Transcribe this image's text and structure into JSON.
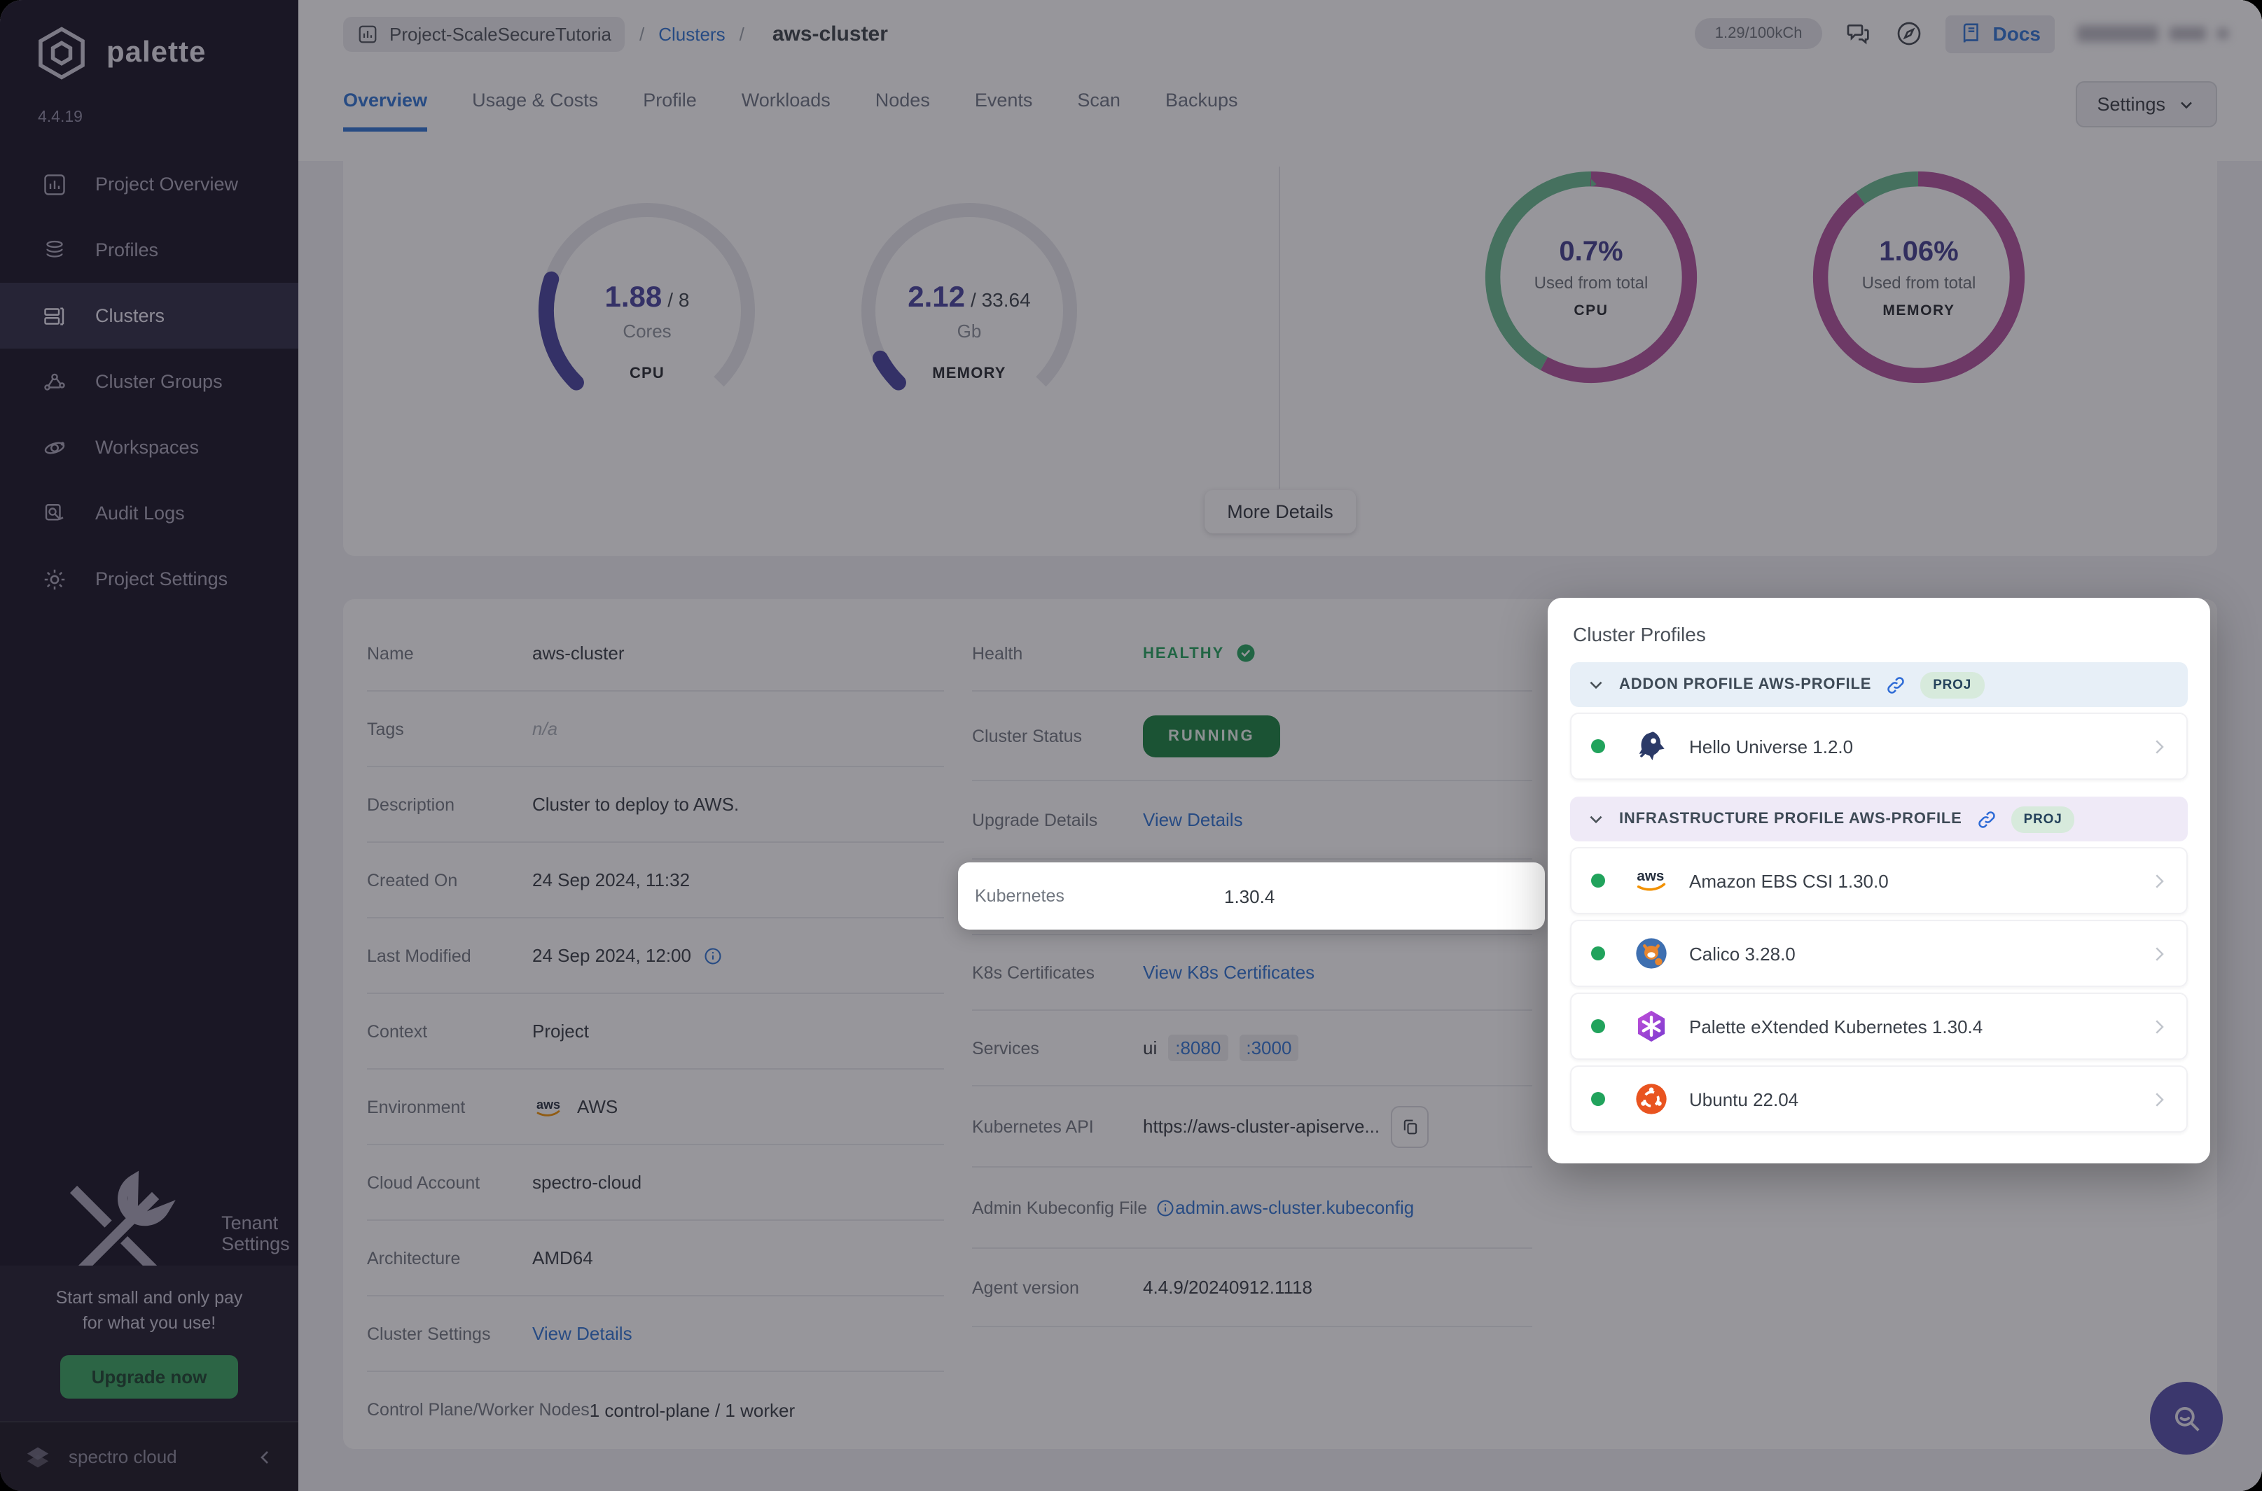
{
  "brand": {
    "name": "palette",
    "version": "4.4.19",
    "footer": "spectro cloud"
  },
  "sidebar": {
    "items": [
      {
        "label": "Project Overview"
      },
      {
        "label": "Profiles"
      },
      {
        "label": "Clusters"
      },
      {
        "label": "Cluster Groups"
      },
      {
        "label": "Workspaces"
      },
      {
        "label": "Audit Logs"
      },
      {
        "label": "Project Settings"
      }
    ],
    "active_item": "Clusters",
    "tenant_settings": "Tenant Settings",
    "promo_line1": "Start small and only pay",
    "promo_line2": "for what you use!",
    "upgrade_cta": "Upgrade now"
  },
  "header": {
    "project": "Project-ScaleSecureTutoria",
    "sep1": "/",
    "section": "Clusters",
    "sep2": "/",
    "current": "aws-cluster",
    "usage_badge": "1.29/100kCh",
    "docs_label": "Docs"
  },
  "tabs": {
    "t0": "Overview",
    "t1": "Usage & Costs",
    "t2": "Profile",
    "t3": "Workloads",
    "t4": "Nodes",
    "t5": "Events",
    "t6": "Scan",
    "t7": "Backups",
    "active": "Overview",
    "settings": "Settings"
  },
  "summary": {
    "more_details": "More Details"
  },
  "metrics": {
    "cpu_gauge": {
      "used": "1.88",
      "total": "/ 8",
      "unit": "Cores",
      "label": "CPU",
      "fraction": 0.235,
      "dash_track": "75 25",
      "dash_fill": "17.6 82.4"
    },
    "memory_gauge": {
      "used": "2.12",
      "total": "/ 33.64",
      "unit": "Gb",
      "label": "MEMORY",
      "fraction": 0.063,
      "dash_track": "75 25",
      "dash_fill": "4.7 95.3"
    },
    "cpu_donut": {
      "value": "0.7%",
      "caption": "Used from total",
      "label": "CPU",
      "green_fraction": 0.42,
      "dash_primary": "58 42",
      "dash_secondary": "42 58",
      "offset_secondary": "-58"
    },
    "memory_donut": {
      "value": "1.06%",
      "caption": "Used from total",
      "label": "MEMORY",
      "green_fraction": 0.1,
      "dash_primary": "90 10",
      "dash_secondary": "10 90",
      "offset_secondary": "-90"
    }
  },
  "details": {
    "left": [
      {
        "label": "Name",
        "value": "aws-cluster"
      },
      {
        "label": "Tags",
        "value": "n/a"
      },
      {
        "label": "Description",
        "value": "Cluster to deploy to AWS."
      },
      {
        "label": "Created On",
        "value": "24 Sep 2024, 11:32"
      },
      {
        "label": "Last Modified",
        "value": "24 Sep 2024, 12:00"
      },
      {
        "label": "Context",
        "value": "Project"
      },
      {
        "label": "Environment",
        "value": "AWS"
      },
      {
        "label": "Cloud Account",
        "value": "spectro-cloud"
      },
      {
        "label": "Architecture",
        "value": "AMD64"
      },
      {
        "label": "Cluster Settings",
        "value": "View Details"
      },
      {
        "label": "Control Plane/Worker Nodes",
        "value": "1 control-plane / 1 worker"
      }
    ],
    "right": [
      {
        "label": "Health",
        "value": "HEALTHY"
      },
      {
        "label": "Cluster Status",
        "value": "RUNNING"
      },
      {
        "label": "Upgrade Details",
        "value": "View Details"
      },
      {
        "label": "Kubernetes",
        "value": "1.30.4"
      },
      {
        "label": "K8s Certificates",
        "value": "View K8s Certificates"
      },
      {
        "label": "Services",
        "value": "ui",
        "port1": ":8080",
        "port2": ":3000"
      },
      {
        "label": "Kubernetes API",
        "value": "https://aws-cluster-apiserve..."
      },
      {
        "label": "Admin Kubeconfig File",
        "value": "admin.aws-cluster.kubeconfig"
      },
      {
        "label": "Agent version",
        "value": "4.4.9/20240912.1118"
      }
    ]
  },
  "profiles": {
    "title": "Cluster Profiles",
    "badge": "PROJ",
    "addon_header": "ADDON PROFILE AWS-PROFILE",
    "infra_header": "INFRASTRUCTURE PROFILE AWS-PROFILE",
    "addon_items": [
      {
        "name": "Hello Universe 1.2.0"
      }
    ],
    "infra_items": [
      {
        "name": "Amazon EBS CSI 1.30.0"
      },
      {
        "name": "Calico 3.28.0"
      },
      {
        "name": "Palette eXtended Kubernetes 1.30.4"
      },
      {
        "name": "Ubuntu 22.04"
      }
    ]
  },
  "colors": {
    "accent_blue": "#2D72D2",
    "healthy_green": "#21A35C",
    "running_bg": "#15803D",
    "gauge_fill": "#45409E",
    "donut_primary": "#B0509C",
    "donut_secondary": "#66B98F",
    "upgrade_green": "#35A25D",
    "sidebar_bg": "#131020",
    "fab_bg": "#514DA8"
  }
}
